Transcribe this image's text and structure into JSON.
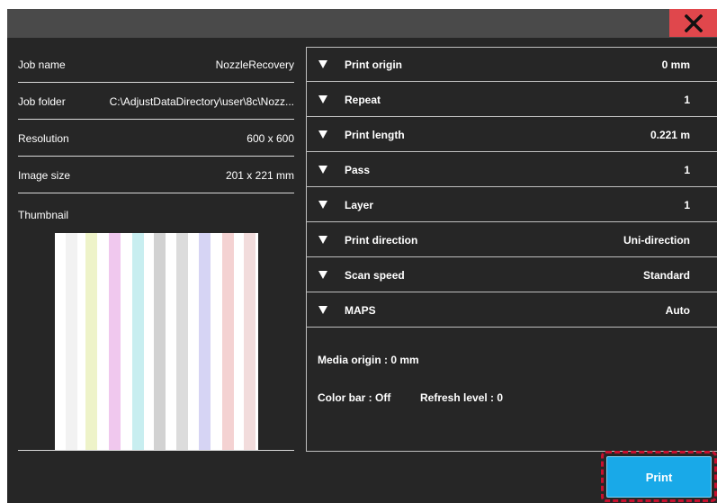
{
  "info": {
    "job_name_label": "Job name",
    "job_name": "NozzleRecovery",
    "job_folder_label": "Job folder",
    "job_folder": "C:\\AdjustDataDirectory\\user\\8c\\Nozz...",
    "resolution_label": "Resolution",
    "resolution": "600 x 600",
    "image_size_label": "Image size",
    "image_size": "201 x 221 mm",
    "thumbnail_label": "Thumbnail"
  },
  "settings": [
    {
      "name": "Print origin",
      "value": "0 mm"
    },
    {
      "name": "Repeat",
      "value": "1"
    },
    {
      "name": "Print length",
      "value": "0.221 m"
    },
    {
      "name": "Pass",
      "value": "1"
    },
    {
      "name": "Layer",
      "value": "1"
    },
    {
      "name": "Print direction",
      "value": "Uni-direction"
    },
    {
      "name": "Scan speed",
      "value": "Standard"
    },
    {
      "name": "MAPS",
      "value": "Auto"
    }
  ],
  "summary": {
    "media_origin": "Media origin : 0 mm",
    "color_bar": "Color bar : Off",
    "refresh_level": "Refresh level : 0"
  },
  "actions": {
    "print_label": "Print",
    "close_icon": "close-icon"
  },
  "colors": {
    "dialog_bg": "#262626",
    "titlebar_bg": "#4a4a4a",
    "close_bg": "#e0474c",
    "print_bg": "#19a9e8",
    "highlight_outline": "#c8102e",
    "thumbnail_stripes": [
      "#f2f2f2",
      "#eef3c9",
      "#f0c8ee",
      "#c8eef0",
      "#d2d2d2",
      "#dcdcdc",
      "#d6d4f4",
      "#f4d2d2",
      "#f2dcdc"
    ]
  }
}
